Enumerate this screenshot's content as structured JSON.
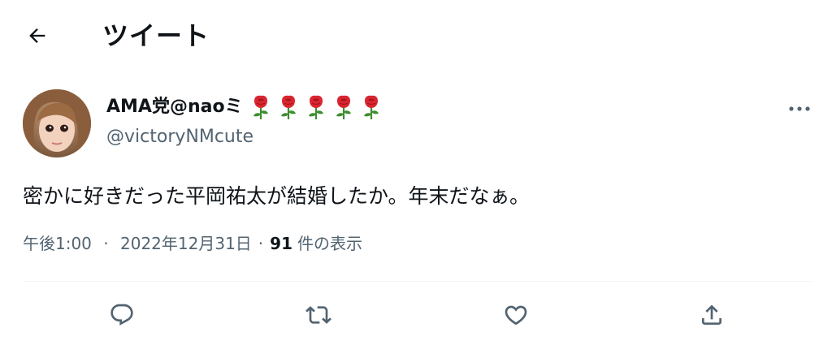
{
  "header": {
    "title": "ツイート",
    "back_icon": "arrow-left-icon"
  },
  "author": {
    "display_name": "AMA党@naoミ",
    "name_emoji": [
      "rose",
      "rose",
      "rose",
      "rose",
      "rose"
    ],
    "handle": "@victoryNMcute",
    "avatar_icon": "profile-photo"
  },
  "more_icon": "more-dots-icon",
  "tweet": {
    "text": "密かに好きだった平岡祐太が結婚したか。年末だなぁ。",
    "time": "午後1:00",
    "separator": "·",
    "date": "2022年12月31日",
    "views_count": "91",
    "views_label": "件の表示"
  },
  "actions": [
    {
      "name": "reply",
      "icon": "reply-icon"
    },
    {
      "name": "retweet",
      "icon": "retweet-icon"
    },
    {
      "name": "like",
      "icon": "heart-icon"
    },
    {
      "name": "share",
      "icon": "share-icon"
    }
  ],
  "colors": {
    "text_primary": "#0f1419",
    "text_secondary": "#536471",
    "divider": "#eff3f4",
    "rose_red": "#d92630",
    "rose_green": "#3e8e2f"
  }
}
